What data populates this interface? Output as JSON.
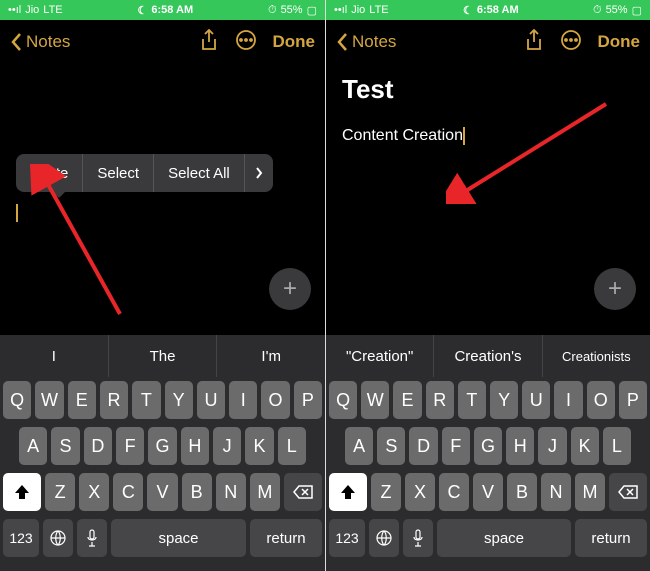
{
  "status": {
    "carrier": "Jio",
    "network": "LTE",
    "time": "6:58 AM",
    "battery": "55%"
  },
  "nav": {
    "back": "Notes",
    "done": "Done"
  },
  "left": {
    "context": {
      "paste": "Paste",
      "select": "Select",
      "selectAll": "Select All"
    },
    "suggestions": [
      "I",
      "The",
      "I'm"
    ]
  },
  "right": {
    "title": "Test",
    "body": "Content Creation",
    "suggestions": [
      "\"Creation\"",
      "Creation's",
      "Creationists"
    ]
  },
  "keyboard": {
    "row1": [
      "Q",
      "W",
      "E",
      "R",
      "T",
      "Y",
      "U",
      "I",
      "O",
      "P"
    ],
    "row2": [
      "A",
      "S",
      "D",
      "F",
      "G",
      "H",
      "J",
      "K",
      "L"
    ],
    "row3": [
      "Z",
      "X",
      "C",
      "V",
      "B",
      "N",
      "M"
    ],
    "numKey": "123",
    "space": "space",
    "return": "return"
  },
  "title_right": "Test"
}
